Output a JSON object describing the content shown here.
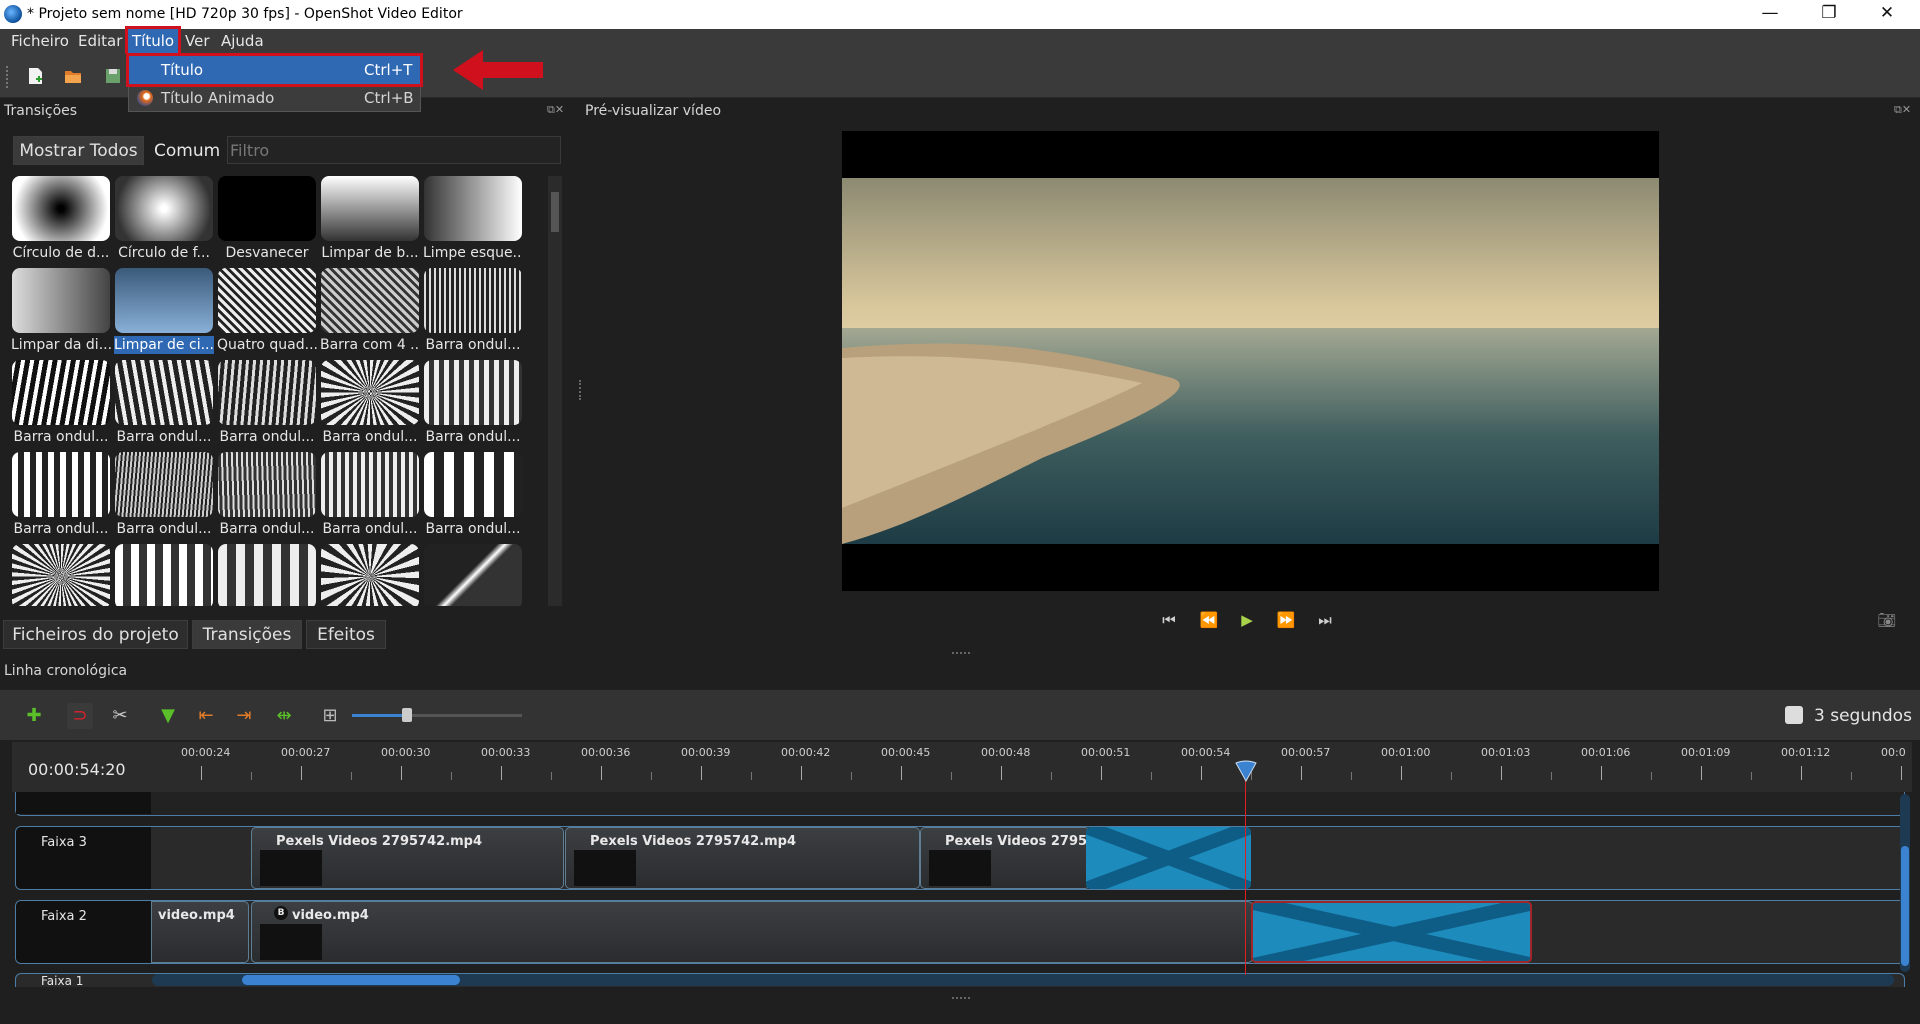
{
  "window": {
    "title": "* Projeto sem nome [HD 720p 30 fps] - OpenShot Video Editor",
    "minimize": "—",
    "maximize": "❐",
    "close": "✕"
  },
  "menubar": {
    "items": [
      "Ficheiro",
      "Editar",
      "Título",
      "Ver",
      "Ajuda"
    ]
  },
  "dropdown": {
    "items": [
      {
        "label": "Título",
        "shortcut": "Ctrl+T"
      },
      {
        "label": "Título Animado",
        "shortcut": "Ctrl+B"
      }
    ]
  },
  "transitions_panel": {
    "title": "Transições",
    "filter_show_all": "Mostrar Todos",
    "filter_common": "Comum",
    "filter_placeholder": "Filtro",
    "items": [
      "Círculo de d...",
      "Círculo de f...",
      "Desvanecer",
      "Limpar de b...",
      "Limpe esque...",
      "Limpar da di...",
      "Limpar de ci...",
      "Quatro quad...",
      "Barra com 4 ...",
      "Barra ondul...",
      "Barra ondul...",
      "Barra ondul...",
      "Barra ondul...",
      "Barra ondul...",
      "Barra ondul...",
      "Barra ondul...",
      "Barra ondul...",
      "Barra ondul...",
      "Barra ondul...",
      "Barra ondul...",
      "",
      "",
      "",
      "",
      ""
    ],
    "selected_index": 6
  },
  "bottom_tabs": [
    "Ficheiros do projeto",
    "Transições",
    "Efeitos"
  ],
  "preview_panel": {
    "title": "Pré-visualizar vídeo"
  },
  "timeline": {
    "title": "Linha cronológica",
    "zoom_label": "3 segundos",
    "timecode": "00:00:54:20",
    "ruler_ticks": [
      "00:00:24",
      "00:00:27",
      "00:00:30",
      "00:00:33",
      "00:00:36",
      "00:00:39",
      "00:00:42",
      "00:00:45",
      "00:00:48",
      "00:00:51",
      "00:00:54",
      "00:00:57",
      "00:01:00",
      "00:01:03",
      "00:01:06",
      "00:01:09",
      "00:01:12",
      "00:0"
    ],
    "tracks": [
      {
        "name": "Faixa 3",
        "clips": [
          "Pexels Videos 2795742.mp4",
          "Pexels Videos 2795742.mp4",
          "Pexels Videos 2795742.r"
        ]
      },
      {
        "name": "Faixa 2",
        "clips": [
          "video.mp4",
          "video.mp4"
        ],
        "badge": "B"
      },
      {
        "name": "Faixa 1",
        "clips": []
      }
    ]
  },
  "colors": {
    "accent": "#2f68b3",
    "highlight": "#d0101c",
    "transition": "#1e8bbd",
    "playhead": "#e02020"
  }
}
